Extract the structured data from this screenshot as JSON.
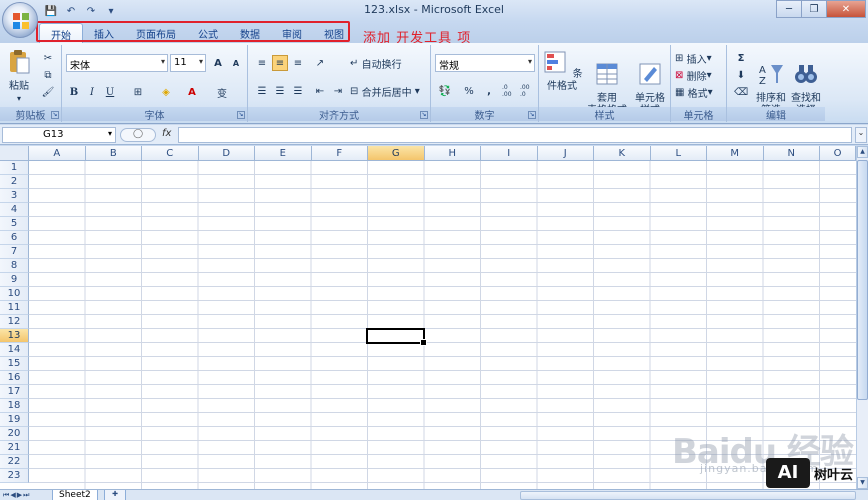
{
  "window": {
    "title": "123.xlsx - Microsoft Excel",
    "controls": [
      "─",
      "❐",
      "✕"
    ]
  },
  "quick_access": {
    "save": "💾",
    "undo": "↶",
    "redo": "↷",
    "customize": "▾"
  },
  "tabs": [
    {
      "label": "开始",
      "active": true
    },
    {
      "label": "插入"
    },
    {
      "label": "页面布局"
    },
    {
      "label": "公式"
    },
    {
      "label": "数据"
    },
    {
      "label": "审阅"
    },
    {
      "label": "视图"
    }
  ],
  "annotation": "添加  开发工具  项",
  "ribbon_right_icons": [
    "?",
    "─",
    "❐",
    "✕"
  ],
  "ribbon": {
    "clipboard": {
      "label": "剪贴板",
      "paste": "粘贴"
    },
    "font": {
      "label": "字体",
      "name": "宋体",
      "size": "11",
      "grow": "A",
      "shrink": "A",
      "bold": "B",
      "italic": "I",
      "underline": "U",
      "phonetic": "变"
    },
    "alignment": {
      "label": "对齐方式",
      "wrap": "自动换行",
      "merge": "合并后居中"
    },
    "number": {
      "label": "数字",
      "format": "常规",
      "percent": "%",
      "comma": ",",
      "inc_decimal": ".0 .00",
      "dec_decimal": ".00 .0"
    },
    "styles": {
      "label": "样式",
      "conditional": "条件格式",
      "table": "套用\n表格格式",
      "cell": "单元格\n样式"
    },
    "cells": {
      "label": "单元格",
      "insert": "插入",
      "delete": "删除",
      "format": "格式"
    },
    "editing": {
      "label": "编辑",
      "sort": "排序和\n筛选",
      "find": "查找和\n选择",
      "sum": "Σ"
    }
  },
  "formula_bar": {
    "namebox": "G13",
    "fx": "fx",
    "value": ""
  },
  "grid": {
    "columns": [
      "A",
      "B",
      "C",
      "D",
      "E",
      "F",
      "G",
      "H",
      "I",
      "J",
      "K",
      "L",
      "M",
      "N",
      "O"
    ],
    "rows": [
      "1",
      "2",
      "3",
      "4",
      "5",
      "6",
      "7",
      "8",
      "9",
      "10",
      "11",
      "12",
      "13",
      "14",
      "15",
      "16",
      "17",
      "18",
      "19",
      "20",
      "21",
      "22",
      "23"
    ],
    "selected_col": "G",
    "selected_row": "13"
  },
  "sheets": {
    "active": "Sheet2"
  },
  "watermark": {
    "baidu": "Baidu 经验",
    "sub": "jingyan.baidu.com",
    "ai": "AI",
    "brand": "树叶云"
  }
}
